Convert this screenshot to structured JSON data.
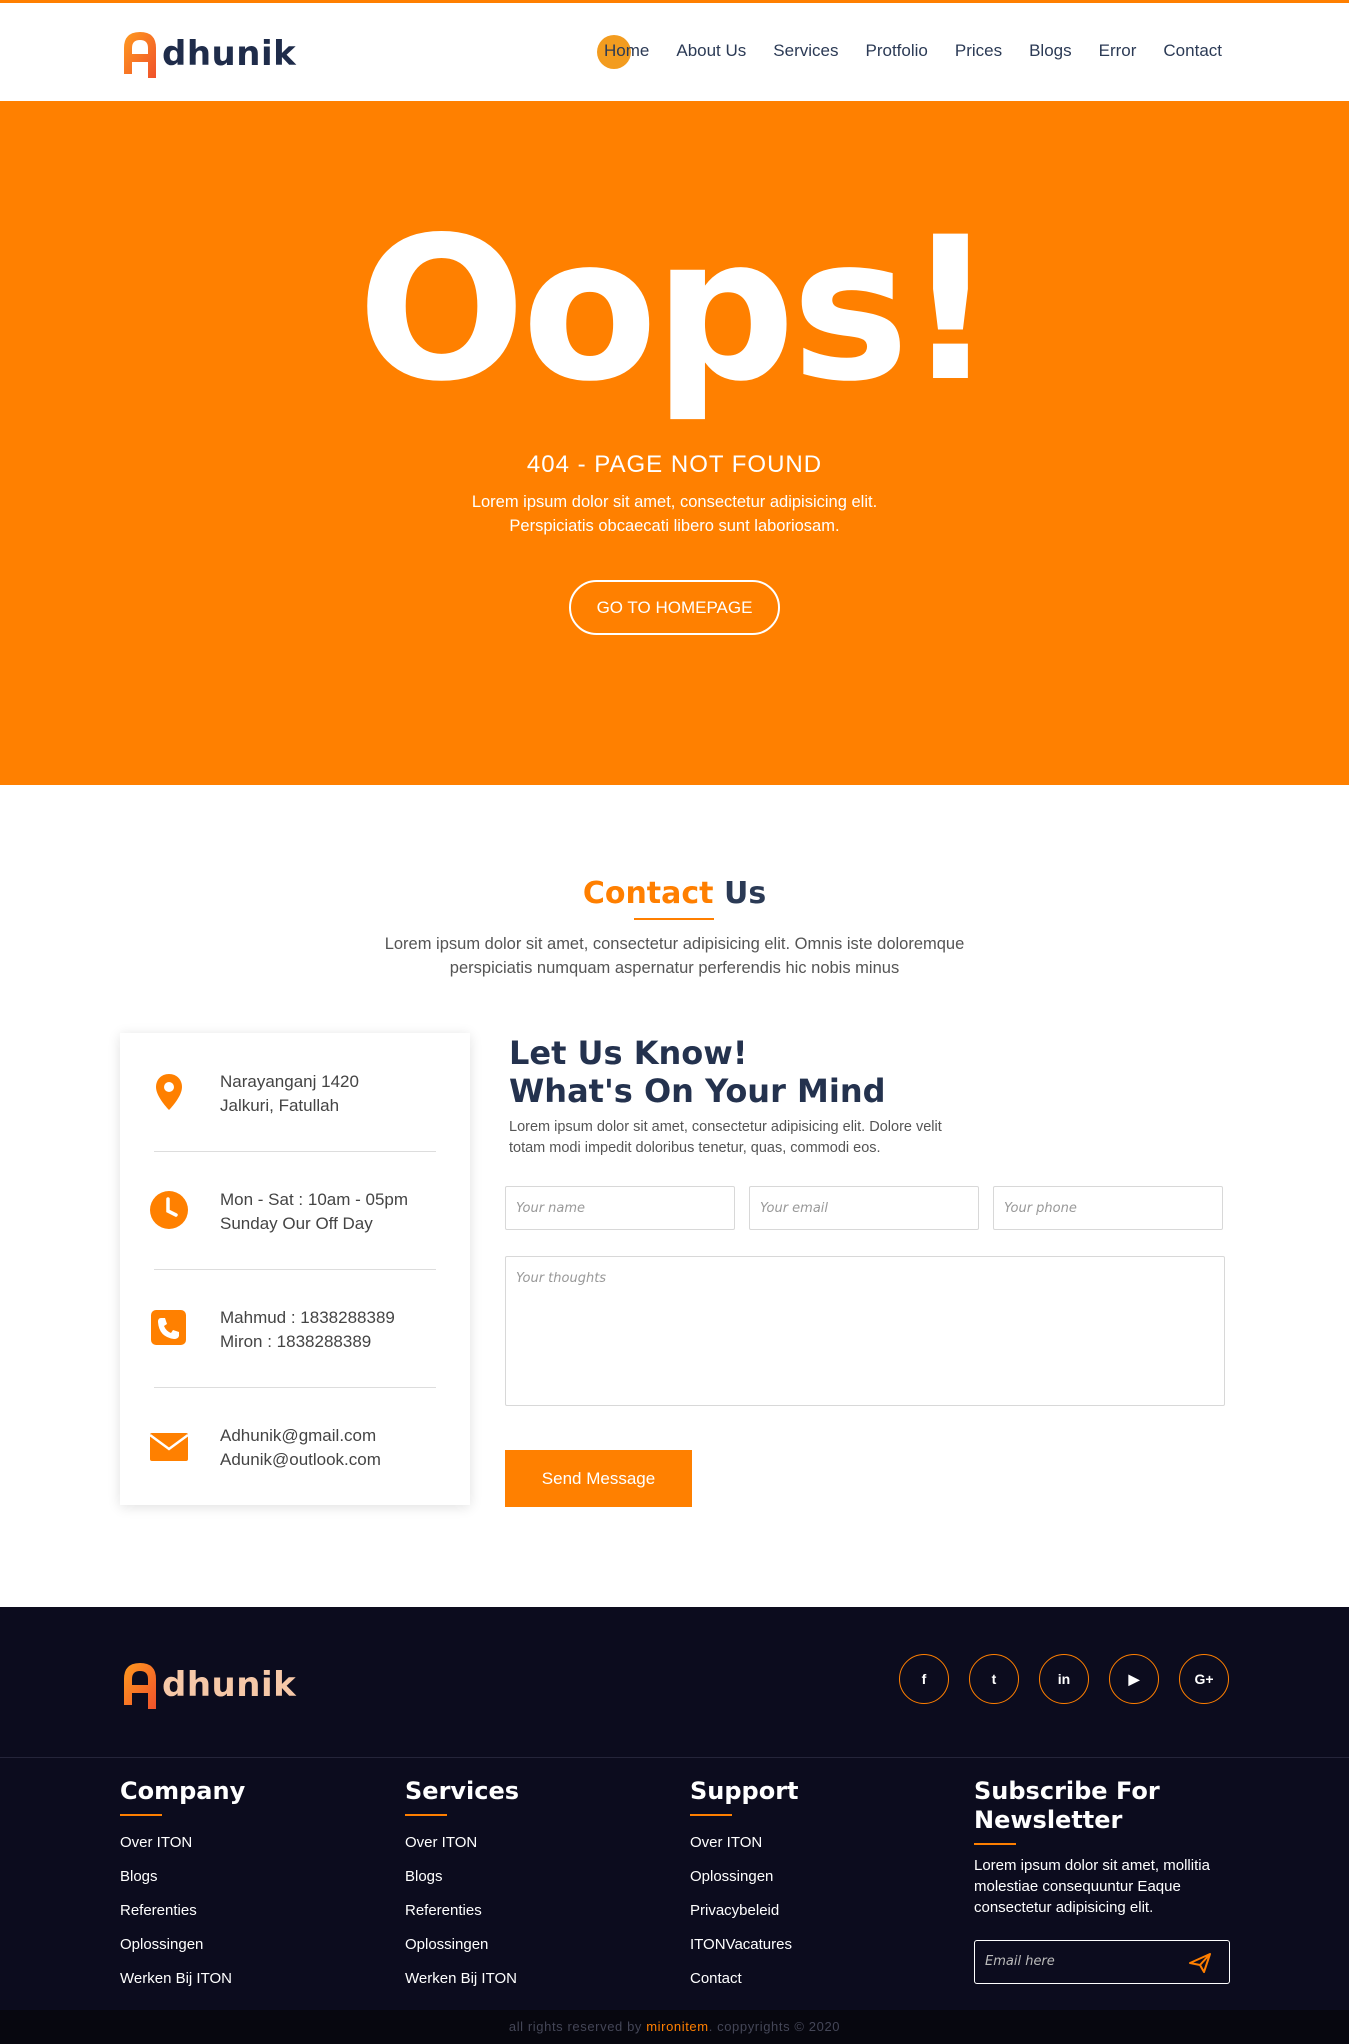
{
  "brand": {
    "logo_text": "dhunik",
    "logo_letter": "A",
    "accent_color": "#ff8000",
    "dark_color": "#0c0c1e"
  },
  "nav": {
    "items": [
      "Home",
      "About Us",
      "Services",
      "Protfolio",
      "Prices",
      "Blogs",
      "Error",
      "Contact"
    ],
    "active": "Home"
  },
  "hero": {
    "headline": "Oops!",
    "code": "404 - PAGE NOT FOUND",
    "desc_line1": "Lorem ipsum dolor sit amet, consectetur adipisicing elit.",
    "desc_line2": "Perspiciatis obcaecati libero sunt laboriosam.",
    "button": "GO TO HOMEPAGE"
  },
  "contact": {
    "title_accent": "Contact",
    "title_rest": "Us",
    "desc_line1": "Lorem ipsum dolor sit amet, consectetur adipisicing elit. Omnis iste doloremque",
    "desc_line2": "perspiciatis numquam aspernatur perferendis hic nobis minus",
    "info": [
      {
        "icon": "map-pin-icon",
        "line1": "Narayanganj 1420",
        "line2": "Jalkuri, Fatullah"
      },
      {
        "icon": "clock-icon",
        "line1": "Mon - Sat : 10am - 05pm",
        "line2": "Sunday Our Off Day"
      },
      {
        "icon": "phone-icon",
        "line1": "Mahmud : 1838288389",
        "line2": "Miron : 1838288389"
      },
      {
        "icon": "envelope-icon",
        "line1": "Adhunik@gmail.com",
        "line2": "Adunik@outlook.com"
      }
    ],
    "form": {
      "title_line1": "Let Us Know!",
      "title_line2": "What's On Your Mind",
      "desc_line1": "Lorem ipsum dolor sit amet, consectetur adipisicing elit. Dolore velit",
      "desc_line2": "totam modi impedit doloribus tenetur, quas, commodi eos.",
      "name_placeholder": "Your name",
      "email_placeholder": "Your email",
      "phone_placeholder": "Your phone",
      "message_placeholder": "Your thoughts",
      "submit": "Send Message"
    }
  },
  "footer": {
    "socials": [
      "facebook-icon",
      "twitter-icon",
      "linkedin-icon",
      "youtube-icon",
      "google-plus-icon"
    ],
    "social_glyphs": [
      "f",
      "t",
      "in",
      "▶",
      "G+"
    ],
    "columns": [
      {
        "title": "Company",
        "links": [
          "Over ITON",
          "Blogs",
          "Referenties",
          "Oplossingen",
          "Werken Bij ITON"
        ]
      },
      {
        "title": "Services",
        "links": [
          "Over ITON",
          "Blogs",
          "Referenties",
          "Oplossingen",
          "Werken Bij ITON"
        ]
      },
      {
        "title": "Support",
        "links": [
          "Over ITON",
          "Oplossingen",
          "Privacybeleid",
          "ITONVacatures",
          "Contact"
        ]
      }
    ],
    "newsletter": {
      "title_line1": "Subscribe For",
      "title_line2": "Newsletter",
      "desc": "Lorem ipsum dolor sit amet, mollitia molestiae consequuntur Eaque consectetur adipisicing elit.",
      "placeholder": "Email here"
    },
    "copyright_pre": "all rights reserved by",
    "copyright_brand": "mironitem",
    "copyright_post": ". coppyrights © 2020"
  }
}
